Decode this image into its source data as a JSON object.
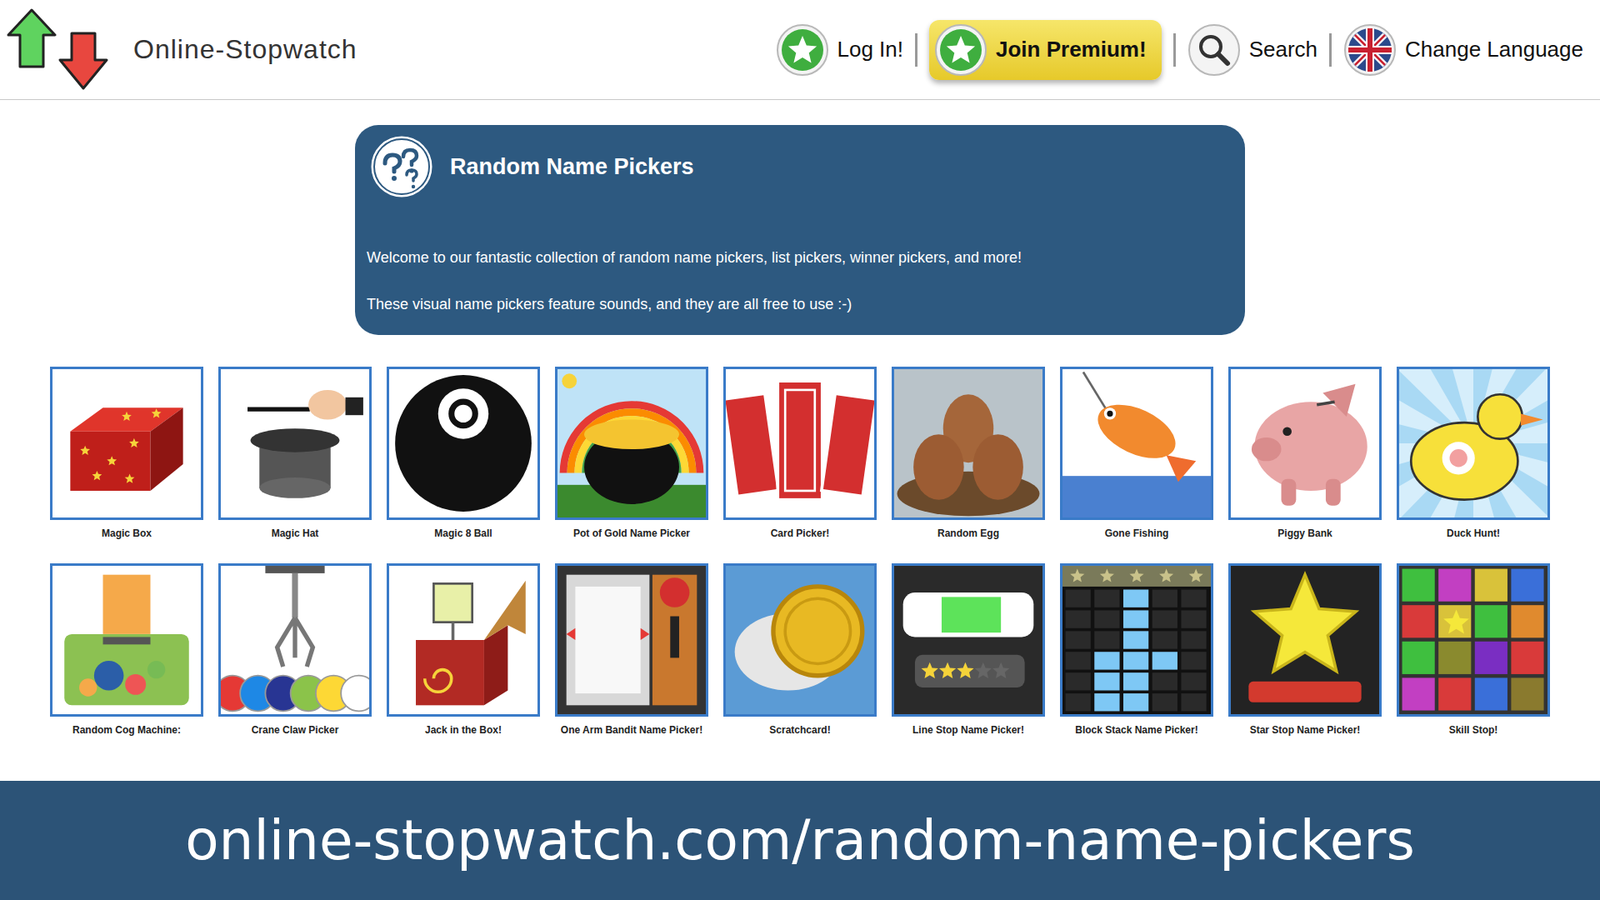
{
  "site": {
    "logo": "Online-Stopwatch"
  },
  "nav": [
    {
      "label": "Log In!",
      "kind": "login"
    },
    {
      "label": "Join Premium!",
      "kind": "premium"
    },
    {
      "label": "Search",
      "kind": "search"
    },
    {
      "label": "Change Language",
      "kind": "language"
    }
  ],
  "banner": {
    "title": "Random Name Pickers",
    "paragraphs": [
      "Welcome to our fantastic collection of random name pickers, list pickers, winner pickers, and more!",
      "These visual name pickers feature sounds, and they are all free to use :-)"
    ]
  },
  "pickers": [
    {
      "label": "Magic Box",
      "kind": "box"
    },
    {
      "label": "Magic Hat",
      "kind": "hat"
    },
    {
      "label": "Magic 8 Ball",
      "kind": "ball"
    },
    {
      "label": "Pot of Gold Name Picker",
      "kind": "gold"
    },
    {
      "label": "Card Picker!",
      "kind": "cards"
    },
    {
      "label": "Random Egg",
      "kind": "egg"
    },
    {
      "label": "Gone Fishing",
      "kind": "fish"
    },
    {
      "label": "Piggy Bank",
      "kind": "piggy"
    },
    {
      "label": "Duck Hunt!",
      "kind": "duck"
    },
    {
      "label": "Random Cog Machine:",
      "kind": "cog"
    },
    {
      "label": "Crane Claw Picker",
      "kind": "claw"
    },
    {
      "label": "Jack in the Box!",
      "kind": "jack"
    },
    {
      "label": "One Arm Bandit Name Picker!",
      "kind": "bandit"
    },
    {
      "label": "Scratchcard!",
      "kind": "scratch"
    },
    {
      "label": "Line Stop Name Picker!",
      "kind": "line"
    },
    {
      "label": "Block Stack Name Picker!",
      "kind": "block"
    },
    {
      "label": "Star Stop Name Picker!",
      "kind": "star"
    },
    {
      "label": "Skill Stop!",
      "kind": "skill"
    }
  ],
  "footer": {
    "url": "online-stopwatch.com/random-name-pickers"
  }
}
